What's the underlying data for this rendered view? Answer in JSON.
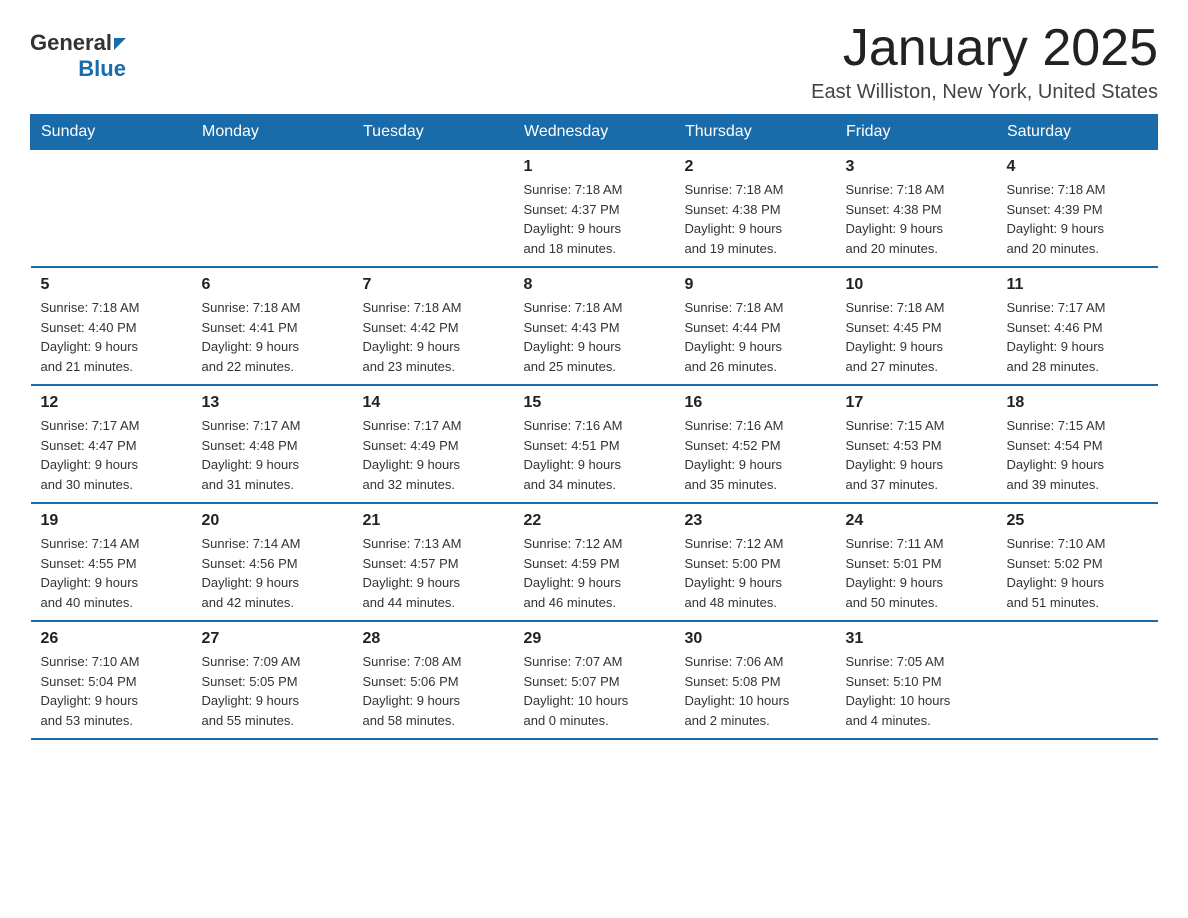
{
  "logo": {
    "text_general": "General",
    "text_blue": "Blue",
    "triangle_symbol": "▶"
  },
  "calendar": {
    "title": "January 2025",
    "subtitle": "East Williston, New York, United States",
    "days_of_week": [
      "Sunday",
      "Monday",
      "Tuesday",
      "Wednesday",
      "Thursday",
      "Friday",
      "Saturday"
    ],
    "weeks": [
      [
        {
          "day": "",
          "info": ""
        },
        {
          "day": "",
          "info": ""
        },
        {
          "day": "",
          "info": ""
        },
        {
          "day": "1",
          "info": "Sunrise: 7:18 AM\nSunset: 4:37 PM\nDaylight: 9 hours\nand 18 minutes."
        },
        {
          "day": "2",
          "info": "Sunrise: 7:18 AM\nSunset: 4:38 PM\nDaylight: 9 hours\nand 19 minutes."
        },
        {
          "day": "3",
          "info": "Sunrise: 7:18 AM\nSunset: 4:38 PM\nDaylight: 9 hours\nand 20 minutes."
        },
        {
          "day": "4",
          "info": "Sunrise: 7:18 AM\nSunset: 4:39 PM\nDaylight: 9 hours\nand 20 minutes."
        }
      ],
      [
        {
          "day": "5",
          "info": "Sunrise: 7:18 AM\nSunset: 4:40 PM\nDaylight: 9 hours\nand 21 minutes."
        },
        {
          "day": "6",
          "info": "Sunrise: 7:18 AM\nSunset: 4:41 PM\nDaylight: 9 hours\nand 22 minutes."
        },
        {
          "day": "7",
          "info": "Sunrise: 7:18 AM\nSunset: 4:42 PM\nDaylight: 9 hours\nand 23 minutes."
        },
        {
          "day": "8",
          "info": "Sunrise: 7:18 AM\nSunset: 4:43 PM\nDaylight: 9 hours\nand 25 minutes."
        },
        {
          "day": "9",
          "info": "Sunrise: 7:18 AM\nSunset: 4:44 PM\nDaylight: 9 hours\nand 26 minutes."
        },
        {
          "day": "10",
          "info": "Sunrise: 7:18 AM\nSunset: 4:45 PM\nDaylight: 9 hours\nand 27 minutes."
        },
        {
          "day": "11",
          "info": "Sunrise: 7:17 AM\nSunset: 4:46 PM\nDaylight: 9 hours\nand 28 minutes."
        }
      ],
      [
        {
          "day": "12",
          "info": "Sunrise: 7:17 AM\nSunset: 4:47 PM\nDaylight: 9 hours\nand 30 minutes."
        },
        {
          "day": "13",
          "info": "Sunrise: 7:17 AM\nSunset: 4:48 PM\nDaylight: 9 hours\nand 31 minutes."
        },
        {
          "day": "14",
          "info": "Sunrise: 7:17 AM\nSunset: 4:49 PM\nDaylight: 9 hours\nand 32 minutes."
        },
        {
          "day": "15",
          "info": "Sunrise: 7:16 AM\nSunset: 4:51 PM\nDaylight: 9 hours\nand 34 minutes."
        },
        {
          "day": "16",
          "info": "Sunrise: 7:16 AM\nSunset: 4:52 PM\nDaylight: 9 hours\nand 35 minutes."
        },
        {
          "day": "17",
          "info": "Sunrise: 7:15 AM\nSunset: 4:53 PM\nDaylight: 9 hours\nand 37 minutes."
        },
        {
          "day": "18",
          "info": "Sunrise: 7:15 AM\nSunset: 4:54 PM\nDaylight: 9 hours\nand 39 minutes."
        }
      ],
      [
        {
          "day": "19",
          "info": "Sunrise: 7:14 AM\nSunset: 4:55 PM\nDaylight: 9 hours\nand 40 minutes."
        },
        {
          "day": "20",
          "info": "Sunrise: 7:14 AM\nSunset: 4:56 PM\nDaylight: 9 hours\nand 42 minutes."
        },
        {
          "day": "21",
          "info": "Sunrise: 7:13 AM\nSunset: 4:57 PM\nDaylight: 9 hours\nand 44 minutes."
        },
        {
          "day": "22",
          "info": "Sunrise: 7:12 AM\nSunset: 4:59 PM\nDaylight: 9 hours\nand 46 minutes."
        },
        {
          "day": "23",
          "info": "Sunrise: 7:12 AM\nSunset: 5:00 PM\nDaylight: 9 hours\nand 48 minutes."
        },
        {
          "day": "24",
          "info": "Sunrise: 7:11 AM\nSunset: 5:01 PM\nDaylight: 9 hours\nand 50 minutes."
        },
        {
          "day": "25",
          "info": "Sunrise: 7:10 AM\nSunset: 5:02 PM\nDaylight: 9 hours\nand 51 minutes."
        }
      ],
      [
        {
          "day": "26",
          "info": "Sunrise: 7:10 AM\nSunset: 5:04 PM\nDaylight: 9 hours\nand 53 minutes."
        },
        {
          "day": "27",
          "info": "Sunrise: 7:09 AM\nSunset: 5:05 PM\nDaylight: 9 hours\nand 55 minutes."
        },
        {
          "day": "28",
          "info": "Sunrise: 7:08 AM\nSunset: 5:06 PM\nDaylight: 9 hours\nand 58 minutes."
        },
        {
          "day": "29",
          "info": "Sunrise: 7:07 AM\nSunset: 5:07 PM\nDaylight: 10 hours\nand 0 minutes."
        },
        {
          "day": "30",
          "info": "Sunrise: 7:06 AM\nSunset: 5:08 PM\nDaylight: 10 hours\nand 2 minutes."
        },
        {
          "day": "31",
          "info": "Sunrise: 7:05 AM\nSunset: 5:10 PM\nDaylight: 10 hours\nand 4 minutes."
        },
        {
          "day": "",
          "info": ""
        }
      ]
    ]
  }
}
